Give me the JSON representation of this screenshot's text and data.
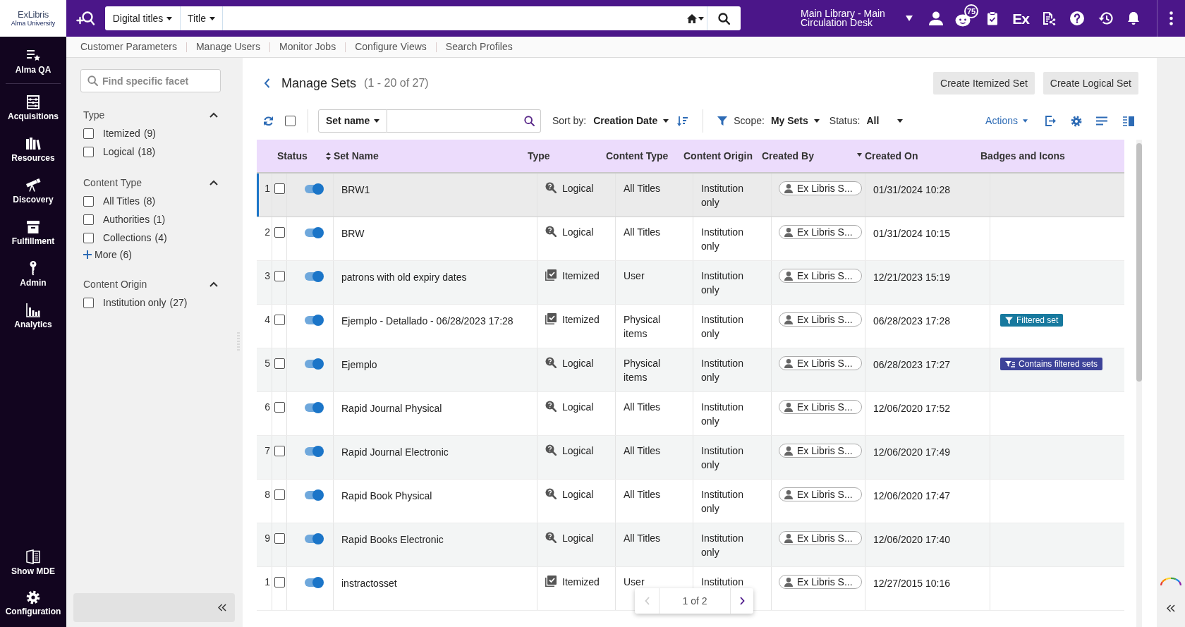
{
  "logo": {
    "brand": "ExLibris",
    "institution": "Alma University"
  },
  "top_bar": {
    "search": {
      "scope": "Digital titles",
      "field": "Title"
    },
    "location": "Main Library - Main Circulation Desk",
    "notification_count": "75",
    "ex_label": "Ex"
  },
  "sub_nav": [
    {
      "label": "Customer Parameters"
    },
    {
      "label": "Manage Users"
    },
    {
      "label": "Monitor Jobs"
    },
    {
      "label": "Configure Views"
    },
    {
      "label": "Search Profiles"
    }
  ],
  "left_nav": {
    "items": [
      {
        "label": "Alma QA"
      },
      {
        "label": "Acquisitions"
      },
      {
        "label": "Resources"
      },
      {
        "label": "Discovery"
      },
      {
        "label": "Fulfillment"
      },
      {
        "label": "Admin"
      },
      {
        "label": "Analytics"
      }
    ],
    "bottom_items": [
      {
        "label": "Show MDE"
      },
      {
        "label": "Configuration"
      }
    ]
  },
  "facets": {
    "search": {
      "placeholder": "Find specific facet"
    },
    "groups": [
      {
        "title": "Type",
        "expanded": true,
        "options": [
          {
            "label": "Itemized",
            "count": "(9)",
            "checked": false
          },
          {
            "label": "Logical",
            "count": "(18)",
            "checked": false
          }
        ]
      },
      {
        "title": "Content Type",
        "expanded": true,
        "options": [
          {
            "label": "All Titles",
            "count": "(8)",
            "checked": false
          },
          {
            "label": "Authorities",
            "count": "(1)",
            "checked": false
          },
          {
            "label": "Collections",
            "count": "(4)",
            "checked": false
          }
        ],
        "more": "More (6)"
      },
      {
        "title": "Content Origin",
        "expanded": true,
        "options": [
          {
            "label": "Institution only",
            "count": "(27)",
            "checked": false
          }
        ]
      }
    ]
  },
  "page": {
    "title": "Manage Sets",
    "range": "(1 - 20 of 27)",
    "buttons": [
      {
        "label": "Create Itemized Set"
      },
      {
        "label": "Create Logical Set"
      }
    ]
  },
  "toolbar": {
    "select_all": {
      "checked": false
    },
    "search_field": {
      "field": "Set name"
    },
    "sort": {
      "label": "Sort by:",
      "value": "Creation Date"
    },
    "scope": {
      "label": "Scope:",
      "value": "My Sets"
    },
    "status": {
      "label": "Status:",
      "value": "All"
    },
    "actions": "Actions"
  },
  "table": {
    "columns": [
      {
        "label": "Status"
      },
      {
        "label": "Set Name",
        "sortable": true
      },
      {
        "label": "Type"
      },
      {
        "label": "Content Type"
      },
      {
        "label": "Content Origin"
      },
      {
        "label": "Created By"
      },
      {
        "label": "Created On",
        "sorted_descending": true
      },
      {
        "label": "Badges and Icons"
      }
    ],
    "rows": [
      {
        "number": "1",
        "selected": true,
        "checked": false,
        "active": true,
        "name": "BRW1",
        "type": {
          "label": "Logical",
          "kind": "logical"
        },
        "content_type": "All Titles",
        "content_origin": "Institution only",
        "created_by": "Ex Libris S...",
        "created_on": "01/31/2024 10:28"
      },
      {
        "number": "2",
        "selected": false,
        "checked": false,
        "active": true,
        "name": "BRW",
        "type": {
          "label": "Logical",
          "kind": "logical"
        },
        "content_type": "All Titles",
        "content_origin": "Institution only",
        "created_by": "Ex Libris S...",
        "created_on": "01/31/2024 10:15"
      },
      {
        "number": "3",
        "selected": false,
        "checked": false,
        "active": true,
        "name": "patrons with old expiry dates",
        "type": {
          "label": "Itemized",
          "kind": "itemized"
        },
        "content_type": "User",
        "content_origin": "Institution only",
        "created_by": "Ex Libris S...",
        "created_on": "12/21/2023 15:19"
      },
      {
        "number": "4",
        "selected": false,
        "checked": false,
        "active": true,
        "name": "Ejemplo - Detallado - 06/28/2023 17:28",
        "type": {
          "label": "Itemized",
          "kind": "itemized"
        },
        "content_type": "Physical items",
        "content_origin": "Institution only",
        "created_by": "Ex Libris S...",
        "created_on": "06/28/2023 17:28",
        "badges": [
          {
            "label": "Filtered set",
            "kind": "filter",
            "color": "#17799e"
          }
        ]
      },
      {
        "number": "5",
        "selected": false,
        "checked": false,
        "active": true,
        "name": "Ejemplo",
        "type": {
          "label": "Logical",
          "kind": "logical"
        },
        "content_type": "Physical items",
        "content_origin": "Institution only",
        "created_by": "Ex Libris S...",
        "created_on": "06/28/2023 17:27",
        "badges": [
          {
            "label": "Contains filtered sets",
            "kind": "contains_filtered",
            "color": "#3d4399"
          }
        ]
      },
      {
        "number": "6",
        "selected": false,
        "checked": false,
        "active": true,
        "name": "Rapid Journal Physical",
        "type": {
          "label": "Logical",
          "kind": "logical"
        },
        "content_type": "All Titles",
        "content_origin": "Institution only",
        "created_by": "Ex Libris S...",
        "created_on": "12/06/2020 17:52"
      },
      {
        "number": "7",
        "selected": false,
        "checked": false,
        "active": true,
        "name": "Rapid Journal Electronic",
        "type": {
          "label": "Logical",
          "kind": "logical"
        },
        "content_type": "All Titles",
        "content_origin": "Institution only",
        "created_by": "Ex Libris S...",
        "created_on": "12/06/2020 17:49"
      },
      {
        "number": "8",
        "selected": false,
        "checked": false,
        "active": true,
        "name": "Rapid Book Physical",
        "type": {
          "label": "Logical",
          "kind": "logical"
        },
        "content_type": "All Titles",
        "content_origin": "Institution only",
        "created_by": "Ex Libris S...",
        "created_on": "12/06/2020 17:47"
      },
      {
        "number": "9",
        "selected": false,
        "checked": false,
        "active": true,
        "name": "Rapid Books Electronic",
        "type": {
          "label": "Logical",
          "kind": "logical"
        },
        "content_type": "All Titles",
        "content_origin": "Institution only",
        "created_by": "Ex Libris S...",
        "created_on": "12/06/2020 17:40"
      },
      {
        "number": "1",
        "selected": false,
        "checked": false,
        "active": true,
        "name": "instractosset",
        "type": {
          "label": "Itemized",
          "kind": "itemized"
        },
        "content_type": "User",
        "content_origin": "Institution",
        "created_by": "Ex Libris S...",
        "created_on": "12/27/2015 10:16"
      }
    ]
  },
  "pager": {
    "label": "1 of 2",
    "previous_disabled": true,
    "next_disabled": false
  }
}
